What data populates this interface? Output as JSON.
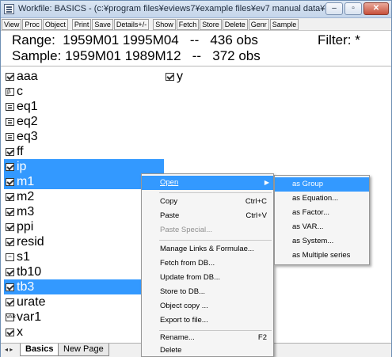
{
  "window": {
    "title": "Workfile: BASICS - (c:¥program files¥eviews7¥example files¥ev7 manual data¥ch...",
    "minimize_glyph": "–",
    "restore_glyph": "▫",
    "close_glyph": "✕"
  },
  "toolbar": {
    "buttons": [
      "View",
      "Proc",
      "Object",
      "Print",
      "Save",
      "Details+/-",
      "Show",
      "Fetch",
      "Store",
      "Delete",
      "Genr",
      "Sample"
    ]
  },
  "header": {
    "range": "Range:  1959M01 1995M04   --   436 obs",
    "sample": "Sample: 1959M01 1989M12   --   372 obs",
    "filter": "Filter: *"
  },
  "objects": [
    {
      "name": "aaa",
      "icon": "series-icon"
    },
    {
      "name": "c",
      "icon": "coefficient-icon"
    },
    {
      "name": "eq1",
      "icon": "equation-icon"
    },
    {
      "name": "eq2",
      "icon": "equation-icon"
    },
    {
      "name": "eq3",
      "icon": "equation-icon"
    },
    {
      "name": "ff",
      "icon": "series-icon"
    },
    {
      "name": "ip",
      "icon": "series-icon"
    },
    {
      "name": "m1",
      "icon": "series-icon"
    },
    {
      "name": "m2",
      "icon": "series-icon"
    },
    {
      "name": "m3",
      "icon": "series-icon"
    },
    {
      "name": "ppi",
      "icon": "series-icon"
    },
    {
      "name": "resid",
      "icon": "series-icon"
    },
    {
      "name": "s1",
      "icon": "sample-icon"
    },
    {
      "name": "tb10",
      "icon": "series-icon"
    },
    {
      "name": "tb3",
      "icon": "series-icon"
    },
    {
      "name": "urate",
      "icon": "series-icon"
    },
    {
      "name": "var1",
      "icon": "var-icon"
    },
    {
      "name": "x",
      "icon": "series-icon"
    },
    {
      "name": "y",
      "icon": "series-icon"
    }
  ],
  "tabs": {
    "active": "Basics",
    "other": "New Page",
    "arrows": "◂ ▸"
  },
  "context_menu": {
    "open": "Open",
    "copy": "Copy",
    "copy_shortcut": "Ctrl+C",
    "paste": "Paste",
    "paste_shortcut": "Ctrl+V",
    "paste_special": "Paste Special...",
    "manage_links": "Manage Links & Formulae...",
    "fetch": "Fetch from DB...",
    "update": "Update from DB...",
    "store": "Store to DB...",
    "object_copy": "Object copy ...",
    "export": "Export to file...",
    "rename": "Rename...",
    "rename_shortcut": "F2",
    "delete": "Delete"
  },
  "submenu": {
    "group": "as Group",
    "equation": "as Equation...",
    "factor": "as Factor...",
    "var": "as VAR...",
    "system": "as System...",
    "multiple": "as Multiple series"
  },
  "colors": {
    "selection": "#3399ff",
    "titlebar": "#c4d5ea"
  }
}
